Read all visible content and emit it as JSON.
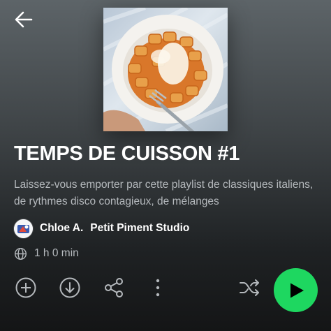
{
  "playlist": {
    "title": "TEMPS DE CUISSON #1",
    "description": "Laissez-vous emporter par cette playlist de classiques italiens, de rythmes disco contagieux, de mélanges",
    "owner_primary": "Chloe A.",
    "owner_secondary": "Petit Piment Studio",
    "duration": "1 h 0 min"
  },
  "icons": {
    "back": "arrow-left-icon",
    "globe": "globe-icon",
    "add": "add-circle-icon",
    "download": "download-circle-icon",
    "share": "share-icon",
    "more": "more-vertical-icon",
    "shuffle": "shuffle-icon",
    "play": "play-icon"
  },
  "colors": {
    "accent": "#1ed760",
    "text_secondary": "#b5b9bd"
  }
}
